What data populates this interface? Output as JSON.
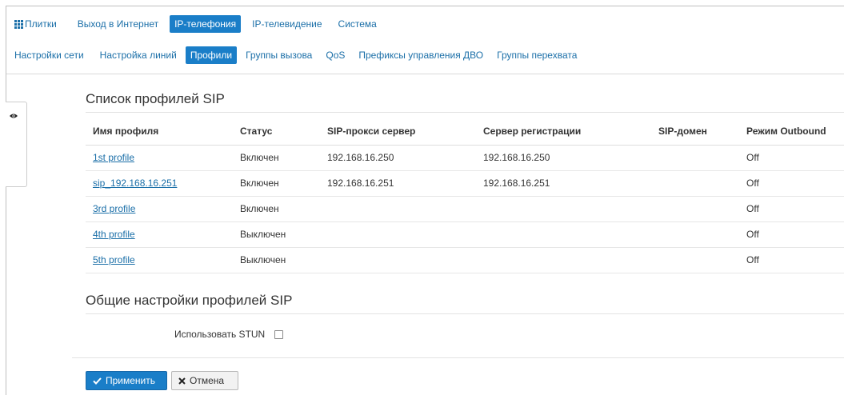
{
  "topnav": {
    "items": [
      {
        "label": "Плитки",
        "icon": "grid-icon"
      },
      {
        "label": "Выход в Интернет"
      },
      {
        "label": "IP-телефония",
        "active": true
      },
      {
        "label": "IP-телевидение"
      },
      {
        "label": "Система"
      }
    ]
  },
  "subnav": {
    "items": [
      {
        "label": "Настройки сети"
      },
      {
        "label": "Настройка линий"
      },
      {
        "label": "Профили",
        "active": true
      },
      {
        "label": "Группы вызова"
      },
      {
        "label": "QoS"
      },
      {
        "label": "Префиксы управления ДВО"
      },
      {
        "label": "Группы перехвата"
      }
    ]
  },
  "side_toggle": {
    "icon": "eye-icon"
  },
  "profiles_section": {
    "title": "Список профилей SIP",
    "columns": [
      "Имя профиля",
      "Статус",
      "SIP-прокси сервер",
      "Сервер регистрации",
      "SIP-домен",
      "Режим Outbound"
    ],
    "rows": [
      {
        "name": "1st profile",
        "status": "Включен",
        "proxy": "192.168.16.250",
        "registrar": "192.168.16.250",
        "domain": "",
        "outbound": "Off"
      },
      {
        "name": "sip_192.168.16.251",
        "status": "Включен",
        "proxy": "192.168.16.251",
        "registrar": "192.168.16.251",
        "domain": "",
        "outbound": "Off"
      },
      {
        "name": "3rd profile",
        "status": "Включен",
        "proxy": "",
        "registrar": "",
        "domain": "",
        "outbound": "Off"
      },
      {
        "name": "4th profile",
        "status": "Выключен",
        "proxy": "",
        "registrar": "",
        "domain": "",
        "outbound": "Off"
      },
      {
        "name": "5th profile",
        "status": "Выключен",
        "proxy": "",
        "registrar": "",
        "domain": "",
        "outbound": "Off"
      }
    ]
  },
  "common_section": {
    "title": "Общие настройки профилей SIP",
    "stun_label": "Использовать STUN",
    "stun_checked": false
  },
  "actions": {
    "apply_label": "Применить",
    "apply_icon": "checkmark-icon",
    "cancel_label": "Отмена",
    "cancel_icon": "x-icon"
  },
  "colors": {
    "accent": "#1a7ec8",
    "link": "#1b6fa8"
  }
}
